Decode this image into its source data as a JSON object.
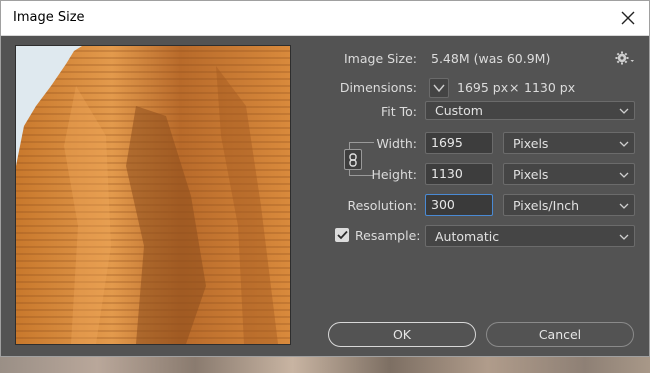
{
  "window": {
    "title": "Image Size"
  },
  "info": {
    "image_size_label": "Image Size:",
    "image_size_value": "5.48M (was 60.9M)",
    "dimensions_label": "Dimensions:",
    "dimensions_width": "1695 px",
    "dimensions_x": "×",
    "dimensions_height": "1130 px"
  },
  "fit_to": {
    "label": "Fit To:",
    "value": "Custom"
  },
  "width": {
    "label": "Width:",
    "value": "1695",
    "unit": "Pixels"
  },
  "height": {
    "label": "Height:",
    "value": "1130",
    "unit": "Pixels"
  },
  "resolution": {
    "label": "Resolution:",
    "value": "300",
    "unit": "Pixels/Inch"
  },
  "resample": {
    "label": "Resample:",
    "checked": true,
    "value": "Automatic"
  },
  "buttons": {
    "ok": "OK",
    "cancel": "Cancel"
  },
  "colors": {
    "dialog_bg": "#535353",
    "focus": "#4a8ad4",
    "rock": "#d98a3c"
  }
}
